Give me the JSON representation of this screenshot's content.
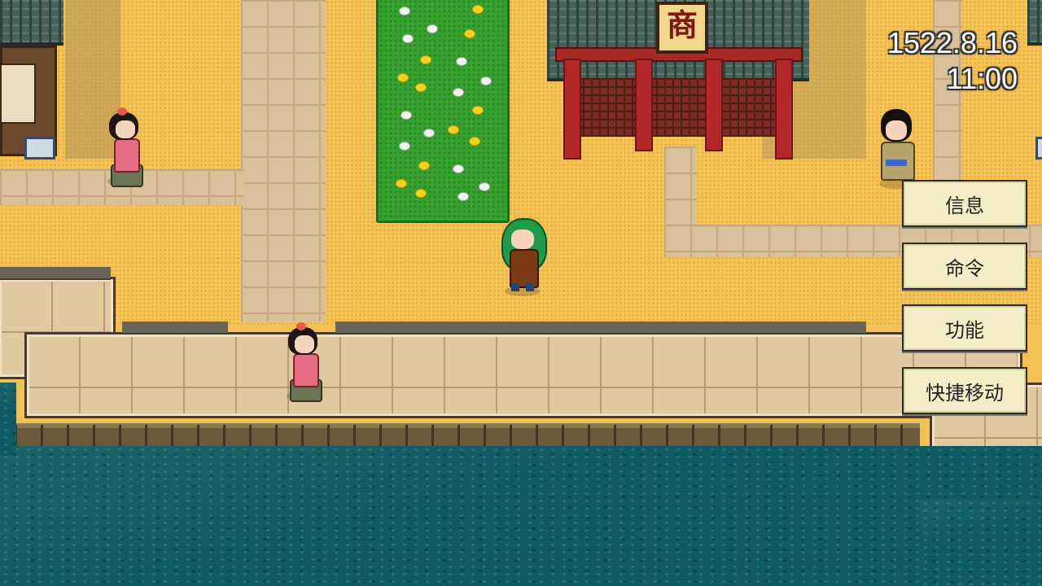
{
  "hud": {
    "date": "1522.8.16",
    "time": "11:00"
  },
  "building": {
    "shop_sign": "商"
  },
  "menu": {
    "items": [
      {
        "label": "信息"
      },
      {
        "label": "命令"
      },
      {
        "label": "功能"
      },
      {
        "label": "快捷移动"
      }
    ]
  },
  "colors": {
    "sand": "#f4c457",
    "water": "#0f5b63",
    "garden": "#36a12e",
    "roof": "#47625b",
    "pillar": "#b3292a",
    "menu_bg": "#f3eec8"
  }
}
